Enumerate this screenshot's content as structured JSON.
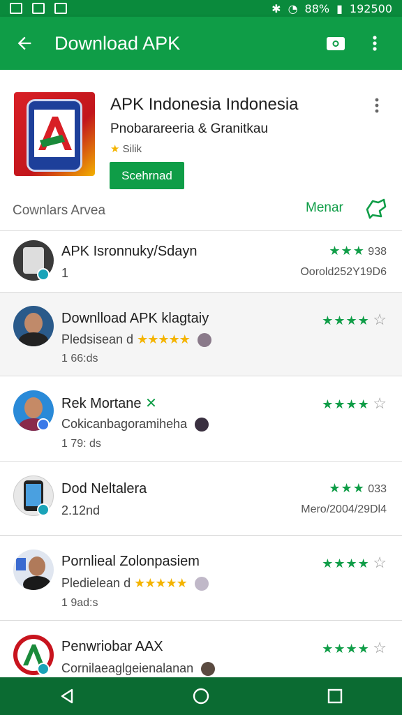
{
  "status_bar": {
    "battery": "88%",
    "time": "192500"
  },
  "app_bar": {
    "title": "Download APK"
  },
  "app": {
    "title": "APK Indonesia Indonesia",
    "developer": "Pnobarareeria &  Granitkau",
    "rating_text": "Silik",
    "install_label": "Scehrnad"
  },
  "section": {
    "label": "Cownlars Arvea",
    "more_label": "Menar"
  },
  "items": [
    {
      "title": "APK Isronnuky/Sdayn",
      "line2": "1",
      "line3": "",
      "right_top": "938",
      "right_bottom": "Oorold252Y19D6"
    },
    {
      "title": "Downlload APK klagtaiy",
      "line2": "Pledsisean d",
      "line3": "1 66:ds",
      "right_top": "",
      "right_bottom": ""
    },
    {
      "title": "Rek Mortane",
      "line2": "Cokicanbagoramiheha",
      "line3": "1 79: ds",
      "right_top": "",
      "right_bottom": ""
    },
    {
      "title": "Dod Neltalera",
      "line2": "2.12nd",
      "line3": "",
      "right_top": "033",
      "right_bottom": "Mero/2004/29Dl4"
    },
    {
      "title": "Pornlieal Zolonpasiem",
      "line2": "Pledielean d",
      "line3": "1 9ad:s",
      "right_top": "",
      "right_bottom": ""
    },
    {
      "title": "Penwriobar AAX",
      "line2": "Cornilaeaglgeienalanan",
      "line3": "",
      "right_top": "",
      "right_bottom": ""
    }
  ],
  "icons": {
    "back": "arrow-left-icon",
    "search": "camera-icon",
    "overflow": "more-vert-icon",
    "more": "puzzle-icon"
  },
  "colors": {
    "primary": "#0f9d47",
    "status": "#0a8a3c",
    "nav": "#0b6b32",
    "star_gold": "#f4b400"
  }
}
